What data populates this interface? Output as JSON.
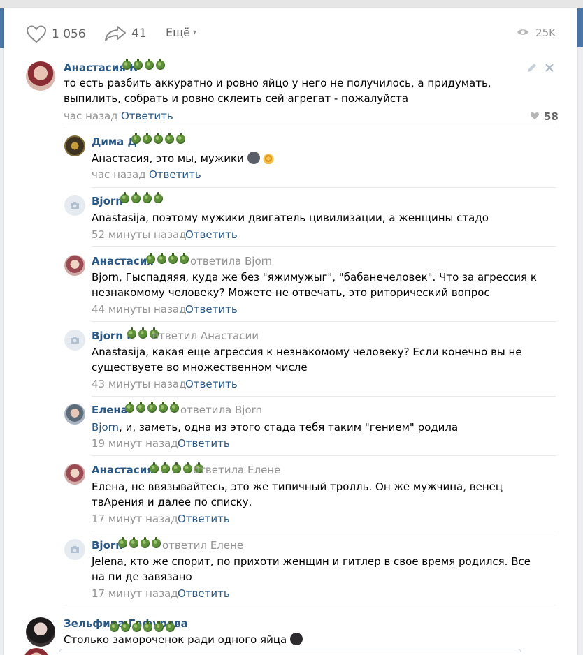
{
  "actions": {
    "likes": "1 056",
    "shares": "41",
    "more_label": "Ещё",
    "views": "25K"
  },
  "main_comment": {
    "author": "Анастасия К",
    "text": "то есть разбить аккуратно и ровно яйцо у него не получилось, а придумать, выпилить, собрать и ровно склеить сей агрегат - пожалуйста",
    "time": "час назад",
    "reply_label": "Ответить",
    "likes": "58"
  },
  "replies": [
    {
      "author": "Дима Д",
      "replied_to": "",
      "text": "Анастасия, это мы, мужики",
      "time": "час назад",
      "reply_label": "Ответить"
    },
    {
      "author": "Bjorn",
      "replied_to": "",
      "text": "Anastasija, поэтому мужики двигатель цивилизации, а женщины стадо",
      "time": "52 минуты назад",
      "reply_label": "Ответить"
    },
    {
      "author": "Анастасия",
      "replied_to": "ответила Bjorn",
      "text": "Bjorn, Гыспадяяя, куда же без \"яжимужыг\", \"бабанечеловек\". Что за агрессия к незнакомому человеку? Можете не отвечать, это риторический вопрос",
      "time": "44 минуты назад",
      "reply_label": "Ответить"
    },
    {
      "author": "Bjorn F",
      "replied_to": "ответил Анастасии",
      "text": "Anastasija, какая еще агрессия к незнакомому человеку? Если конечно вы не существуете во множественном числе",
      "time": "43 минуты назад",
      "reply_label": "Ответить"
    },
    {
      "author": "Елена",
      "replied_to": "ответила Bjorn",
      "mention": "Bjorn",
      "text": ", и, заметь, одна из этого стада тебя таким \"гением\" родила",
      "time": "19 минут назад",
      "reply_label": "Ответить"
    },
    {
      "author": "Анастасия",
      "replied_to": "ответила Елене",
      "text": "Елена, не ввязывайтесь, это же типичный тролль. Он же мужчина, венец твАрения и далее по списку.",
      "time": "17 минут назад",
      "reply_label": "Ответить"
    },
    {
      "author": "Bjorn",
      "replied_to": "ответил Елене",
      "text": "Jelena, кто же спорит, по прихоти женщин и гитлер в свое время родился. Все на пи де завязано",
      "time": "17 минут назад",
      "reply_label": "Ответить"
    }
  ],
  "next_comment": {
    "author": "Зельфира Гафурова",
    "text": "Столько замороченок ради одного яйца"
  },
  "colors": {
    "link": "#2a5885",
    "meta": "#939393",
    "brand": "#4a76a8"
  },
  "icons": [
    "heart-icon",
    "share-icon",
    "eye-icon",
    "pencil-icon",
    "close-icon",
    "camera-icon",
    "like-heart-icon"
  ]
}
